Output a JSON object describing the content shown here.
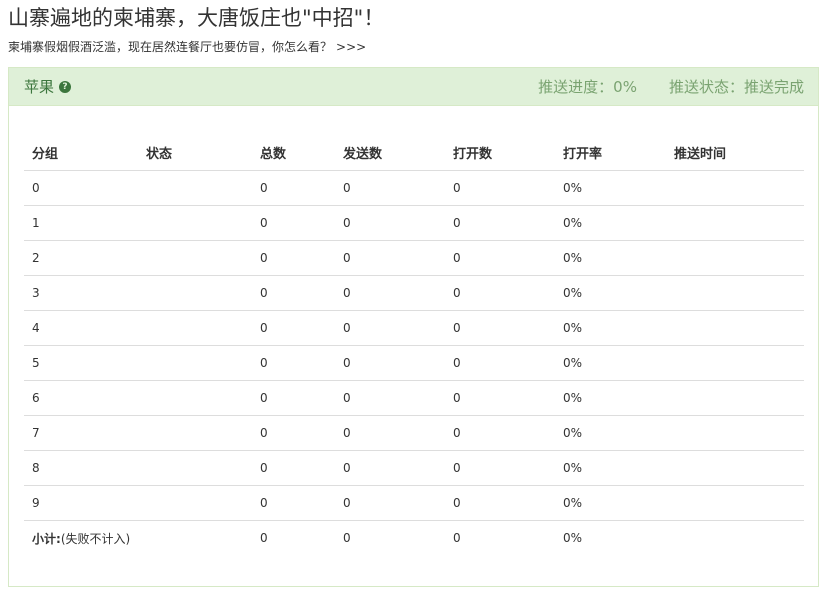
{
  "article": {
    "title": "山寨遍地的柬埔寨，大唐饭庄也\"中招\"！",
    "subtitle": "柬埔寨假烟假酒泛滥，现在居然连餐厅也要仿冒，你怎么看？",
    "more_link": ">>>"
  },
  "panel": {
    "title": "苹果",
    "help_icon": "question-circle-icon",
    "progress_label": "推送进度：",
    "progress_value": "0%",
    "status_label": "推送状态：",
    "status_value": "推送完成",
    "colors": {
      "heading_bg": "#dff0d8",
      "heading_border": "#d6e9c6",
      "heading_text": "#3c763d",
      "heading_right_text": "#7aa371"
    }
  },
  "table": {
    "headers": [
      "分组",
      "状态",
      "总数",
      "发送数",
      "打开数",
      "打开率",
      "推送时间"
    ],
    "rows": [
      {
        "group": "0",
        "status": "",
        "total": "0",
        "sent": "0",
        "opened": "0",
        "open_rate": "0%",
        "push_time": ""
      },
      {
        "group": "1",
        "status": "",
        "total": "0",
        "sent": "0",
        "opened": "0",
        "open_rate": "0%",
        "push_time": ""
      },
      {
        "group": "2",
        "status": "",
        "total": "0",
        "sent": "0",
        "opened": "0",
        "open_rate": "0%",
        "push_time": ""
      },
      {
        "group": "3",
        "status": "",
        "total": "0",
        "sent": "0",
        "opened": "0",
        "open_rate": "0%",
        "push_time": ""
      },
      {
        "group": "4",
        "status": "",
        "total": "0",
        "sent": "0",
        "opened": "0",
        "open_rate": "0%",
        "push_time": ""
      },
      {
        "group": "5",
        "status": "",
        "total": "0",
        "sent": "0",
        "opened": "0",
        "open_rate": "0%",
        "push_time": ""
      },
      {
        "group": "6",
        "status": "",
        "total": "0",
        "sent": "0",
        "opened": "0",
        "open_rate": "0%",
        "push_time": ""
      },
      {
        "group": "7",
        "status": "",
        "total": "0",
        "sent": "0",
        "opened": "0",
        "open_rate": "0%",
        "push_time": ""
      },
      {
        "group": "8",
        "status": "",
        "total": "0",
        "sent": "0",
        "opened": "0",
        "open_rate": "0%",
        "push_time": ""
      },
      {
        "group": "9",
        "status": "",
        "total": "0",
        "sent": "0",
        "opened": "0",
        "open_rate": "0%",
        "push_time": ""
      }
    ],
    "subtotal": {
      "label_bold": "小计:",
      "label_note": "(失败不计入)",
      "total": "0",
      "sent": "0",
      "opened": "0",
      "open_rate": "0%"
    }
  }
}
